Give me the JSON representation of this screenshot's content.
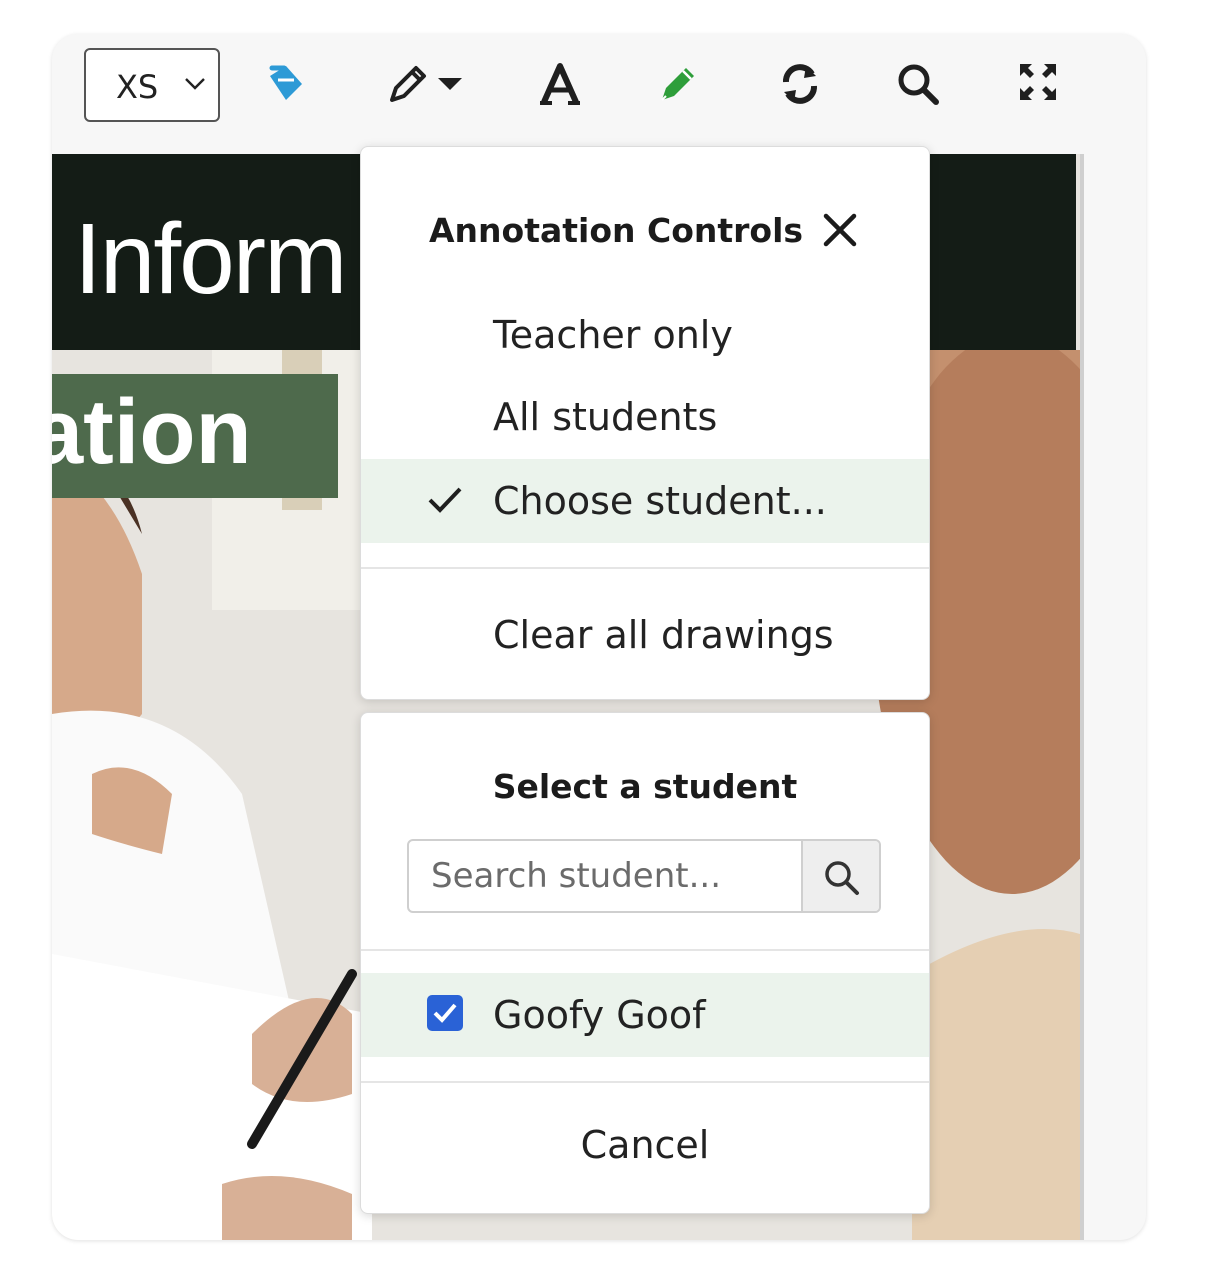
{
  "toolbar": {
    "size_select": {
      "value": "XS"
    },
    "icons": [
      "fill-bucket-icon",
      "pencil-dropdown-icon",
      "text-tool-icon",
      "highlighter-pen-icon",
      "refresh-icon",
      "search-icon",
      "fullscreen-icon"
    ],
    "colors": {
      "fill_bucket": "#2d9ad6",
      "pen_green": "#2e9e3a",
      "dark": "#1f1f1f"
    }
  },
  "background": {
    "banner_word": "Inform",
    "banner_word_2": "ation"
  },
  "annotation_controls": {
    "title": "Annotation Controls",
    "options": [
      {
        "label": "Teacher only",
        "selected": false
      },
      {
        "label": "All students",
        "selected": false
      },
      {
        "label": "Choose student...",
        "selected": true
      }
    ],
    "clear_label": "Clear all drawings"
  },
  "student_picker": {
    "title": "Select a student",
    "search_placeholder": "Search student...",
    "students": [
      {
        "name": "Goofy Goof",
        "checked": true
      }
    ],
    "cancel_label": "Cancel"
  },
  "colors": {
    "selected_row": "#ebf3ec",
    "checkbox": "#2a62d6",
    "banner_dark": "#141c16",
    "banner_green": "#4e6a4c"
  }
}
